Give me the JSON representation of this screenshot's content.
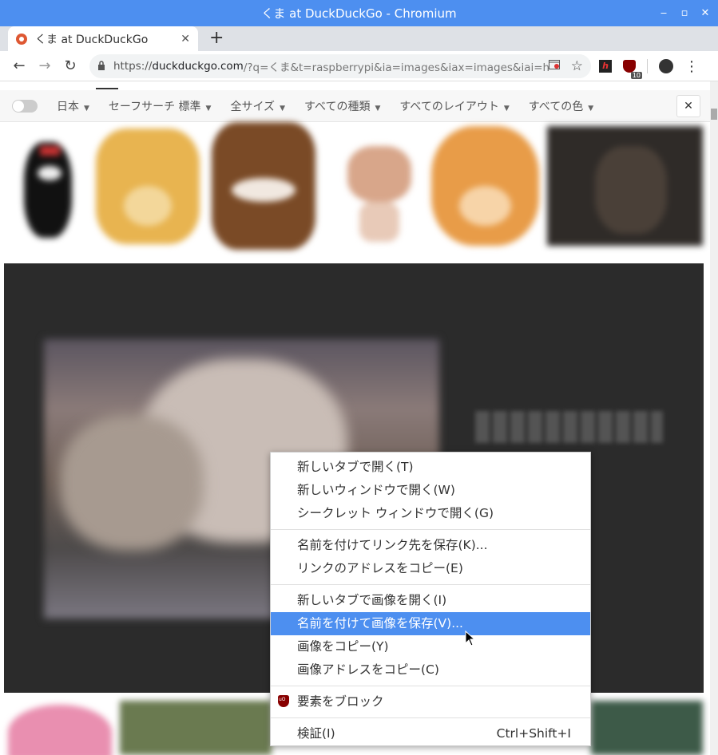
{
  "window": {
    "title": "くま at DuckDuckGo - Chromium",
    "controls": {
      "minimize": "‒",
      "maximize": "▫",
      "close": "✕"
    }
  },
  "tabs": [
    {
      "title": "くま at DuckDuckGo",
      "close": "✕"
    }
  ],
  "new_tab": "+",
  "toolbar": {
    "back": "←",
    "forward": "→",
    "reload": "↻",
    "url_prefix": "https://",
    "url_domain": "duckduckgo.com",
    "url_rest": "/?q=くま&t=raspberrypi&ia=images&iax=images&iai=http...",
    "extension_badge": "10",
    "menu": "⋮"
  },
  "filters": {
    "region": "日本",
    "safesearch": "セーフサーチ 標準",
    "size": "全サイズ",
    "type": "すべての種類",
    "layout": "すべてのレイアウト",
    "color": "すべての色",
    "close": "✕",
    "caret": "▼"
  },
  "context_menu": {
    "group1": [
      {
        "label": "新しいタブで開く(T)"
      },
      {
        "label": "新しいウィンドウで開く(W)"
      },
      {
        "label": "シークレット ウィンドウで開く(G)"
      }
    ],
    "group2": [
      {
        "label": "名前を付けてリンク先を保存(K)..."
      },
      {
        "label": "リンクのアドレスをコピー(E)"
      }
    ],
    "group3": [
      {
        "label": "新しいタブで画像を開く(I)"
      },
      {
        "label": "名前を付けて画像を保存(V)...",
        "selected": true
      },
      {
        "label": "画像をコピー(Y)"
      },
      {
        "label": "画像アドレスをコピー(C)"
      }
    ],
    "ublock": {
      "label": "要素をブロック"
    },
    "inspect": {
      "label": "検証(I)",
      "accelerator": "Ctrl+Shift+I"
    }
  },
  "colors": {
    "titlebar": "#4d8ff0",
    "selection": "#4d8ff0",
    "duckduckgo": "#de5833"
  }
}
